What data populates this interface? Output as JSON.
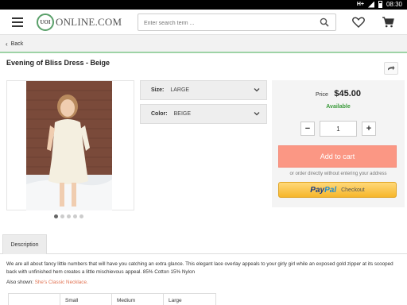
{
  "status_bar": {
    "network": "H+",
    "time": "08:30"
  },
  "header": {
    "logo_seal": "UOI",
    "logo_text": "ONLINE.COM",
    "search_placeholder": "Enter search term ..."
  },
  "nav": {
    "back_label": "Back"
  },
  "product": {
    "title": "Evening of Bliss Dress - Beige",
    "image_dots": 5,
    "active_dot": 0,
    "options": [
      {
        "label": "Size:",
        "value": "LARGE"
      },
      {
        "label": "Color:",
        "value": "BEIGE"
      }
    ]
  },
  "buy": {
    "price_label": "Price",
    "price_value": "$45.00",
    "availability": "Available",
    "quantity": "1",
    "add_to_cart": "Add to cart",
    "or_text": "or order directly without entering your address",
    "paypal_brand_1": "Pay",
    "paypal_brand_2": "Pal",
    "paypal_checkout": "Checkout"
  },
  "description": {
    "tab_label": "Description",
    "text": "We are all about fancy little numbers that will have you catching an extra glance. This elegant lace overlay appeals to your girly girl while an exposed gold zipper at its scooped back with unfinished hem creates a little mischievous appeal. 85% Cotton 15% Nylon",
    "also_shown_label": "Also shown:",
    "also_shown_link": "She's Classic Necklace."
  },
  "size_table": {
    "headers": [
      "",
      "Small",
      "Medium",
      "Large"
    ]
  },
  "colors": {
    "accent_green": "#9ed3a6",
    "available_green": "#3a9a3a",
    "add_to_cart": "#fb9784",
    "link": "#e0704f",
    "paypal_yellow": "#f6b62b"
  }
}
